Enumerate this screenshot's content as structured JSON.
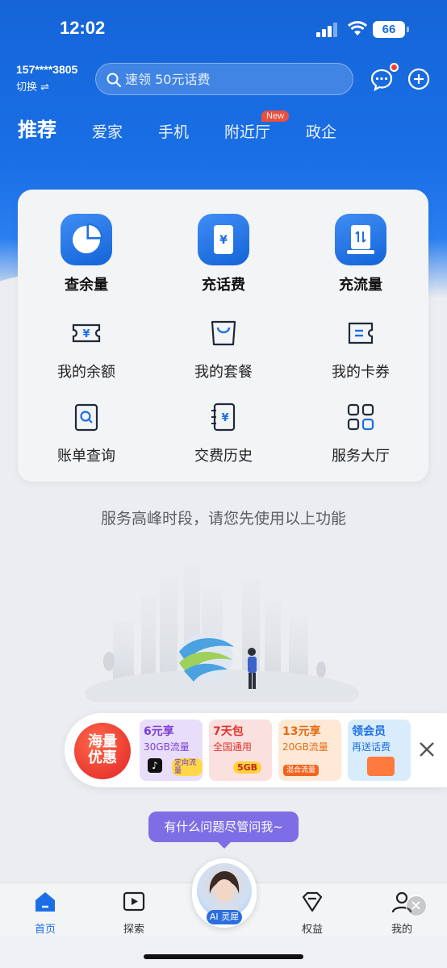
{
  "status_bar": {
    "time": "12:02",
    "battery": "66"
  },
  "header": {
    "phone": "157****3805",
    "switch_label": "切换 ⇌",
    "search_placeholder": "速领 50元话费"
  },
  "tabs": [
    {
      "label": "推荐",
      "active": true
    },
    {
      "label": "爱家"
    },
    {
      "label": "手机"
    },
    {
      "label": "附近厅",
      "badge": "New"
    },
    {
      "label": "政企"
    }
  ],
  "services": {
    "primary": [
      {
        "label": "查余量",
        "icon": "pie-chart-icon"
      },
      {
        "label": "充话费",
        "icon": "yuan-phone-icon"
      },
      {
        "label": "充流量",
        "icon": "data-transfer-icon"
      }
    ],
    "secondary": [
      {
        "label": "我的余额",
        "icon": "yuan-ticket-icon"
      },
      {
        "label": "我的套餐",
        "icon": "bag-icon"
      },
      {
        "label": "我的卡券",
        "icon": "coupon-icon"
      },
      {
        "label": "账单查询",
        "icon": "bill-search-icon"
      },
      {
        "label": "交费历史",
        "icon": "payment-history-icon"
      },
      {
        "label": "服务大厅",
        "icon": "grid-icon"
      }
    ]
  },
  "notice": "服务高峰时段，请您先使用以上功能",
  "promo": {
    "logo": [
      "海量",
      "优惠"
    ],
    "cards": [
      {
        "title": "6元享",
        "sub": "30GB流量",
        "tag": "定向流量",
        "color": "#e9defa",
        "title_color": "#7b3fd8"
      },
      {
        "title": "7天包",
        "sub": "全国通用",
        "tag": "5GB",
        "color": "#fbe0e0",
        "title_color": "#e0332a"
      },
      {
        "title": "13元享",
        "sub": "20GB流量",
        "tag": "混合流量",
        "color": "#fde9d6",
        "title_color": "#e86a14"
      },
      {
        "title": "领会员",
        "sub": "再送话费",
        "tag": "",
        "color": "#d9ecfb",
        "title_color": "#1a6fe6"
      }
    ]
  },
  "ai": {
    "bubble": "有什么问题尽管问我~",
    "label": "AI 灵犀"
  },
  "bottom_nav": [
    {
      "label": "首页",
      "active": true
    },
    {
      "label": "探索"
    },
    {
      "label": "权益"
    },
    {
      "label": "我的"
    }
  ],
  "colors": {
    "brand_blue": "#1a6fe6",
    "badge_red": "#ff4d2e",
    "ai_purple": "#7e6ee6"
  }
}
